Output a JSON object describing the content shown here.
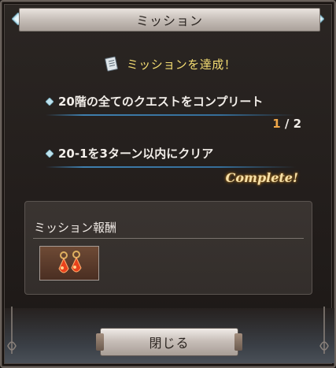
{
  "dialog": {
    "title": "ミッション"
  },
  "header": {
    "text": "ミッションを達成！",
    "icon": "scroll-icon"
  },
  "missions": [
    {
      "text": "20階の全てのクエストをコンプリート",
      "progress_current": "1",
      "progress_sep": " / ",
      "progress_total": "2"
    },
    {
      "text": "20-1を3ターン以内にクリア",
      "status": "Complete!"
    }
  ],
  "rewards": {
    "title": "ミッション報酬",
    "items": [
      {
        "icon": "red-earring-icon"
      }
    ]
  },
  "footer": {
    "close_label": "閉じる"
  },
  "colors": {
    "header_text": "#f3dc72",
    "progress_current": "#f0a84a",
    "complete_text": "#f6e0a8",
    "rule_blue": "#3f7fae"
  }
}
